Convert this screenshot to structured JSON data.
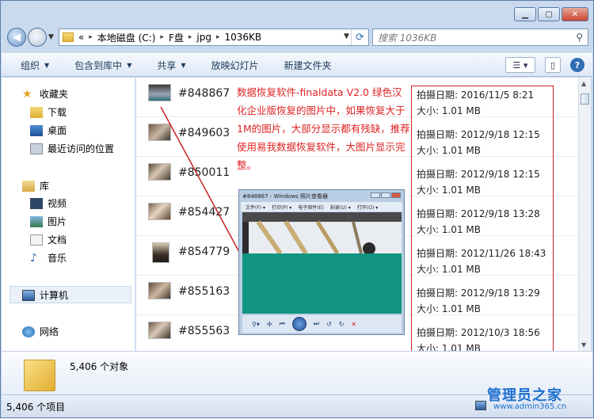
{
  "address": {
    "root": "«",
    "crumbs": [
      "本地磁盘 (C:)",
      "F盘",
      "jpg",
      "1036KB"
    ]
  },
  "search": {
    "placeholder": "搜索 1036KB"
  },
  "toolbar": {
    "items": [
      "组织",
      "包含到库中",
      "共享",
      "放映幻灯片",
      "新建文件夹"
    ]
  },
  "nav": {
    "favorites": "收藏夹",
    "fav_items": [
      "下载",
      "桌面",
      "最近访问的位置"
    ],
    "libraries": "库",
    "lib_items": [
      "视频",
      "图片",
      "文档",
      "音乐"
    ],
    "computer": "计算机",
    "network": "网络"
  },
  "files": [
    {
      "name": "#848867",
      "date": "拍摄日期: 2016/11/5 8:21",
      "size": "大小: 1.01 MB"
    },
    {
      "name": "#849603",
      "date": "拍摄日期: 2012/9/18 12:15",
      "size": "大小: 1.01 MB"
    },
    {
      "name": "#850011",
      "date": "拍摄日期: 2012/9/18 12:15",
      "size": "大小: 1.01 MB"
    },
    {
      "name": "#854427",
      "date": "拍摄日期: 2012/9/18 13:28",
      "size": "大小: 1.01 MB"
    },
    {
      "name": "#854779",
      "date": "拍摄日期: 2012/11/26 18:43",
      "size": "大小: 1.01 MB"
    },
    {
      "name": "#855163",
      "date": "拍摄日期: 2012/9/18 13:29",
      "size": "大小: 1.01 MB"
    },
    {
      "name": "#855563",
      "date": "拍摄日期: 2012/10/3 18:56",
      "size": "大小: 1.01 MB"
    }
  ],
  "annotation": "数据恢复软件-finaldata V2.0 绿色汉化企业版恢复的图片中，如果恢复大于1M的图片，大部分显示都有残缺，推荐使用易我数据恢复软件，大图片显示完整。",
  "viewer": {
    "title": "#848867 - Windows 照片查看器",
    "menu": [
      "文件(F) ▾",
      "打印(P) ▾",
      "电子邮件(E)",
      "刻录(U) ▾",
      "打开(O) ▾"
    ]
  },
  "details": {
    "count": "5,406 个对象"
  },
  "status": {
    "count": "5,406 个项目"
  },
  "watermark": {
    "text": "管理员之家",
    "url": "www.admin365.cn"
  },
  "colors": {
    "annotation": "#dd2222",
    "accent": "#2f6db5"
  }
}
